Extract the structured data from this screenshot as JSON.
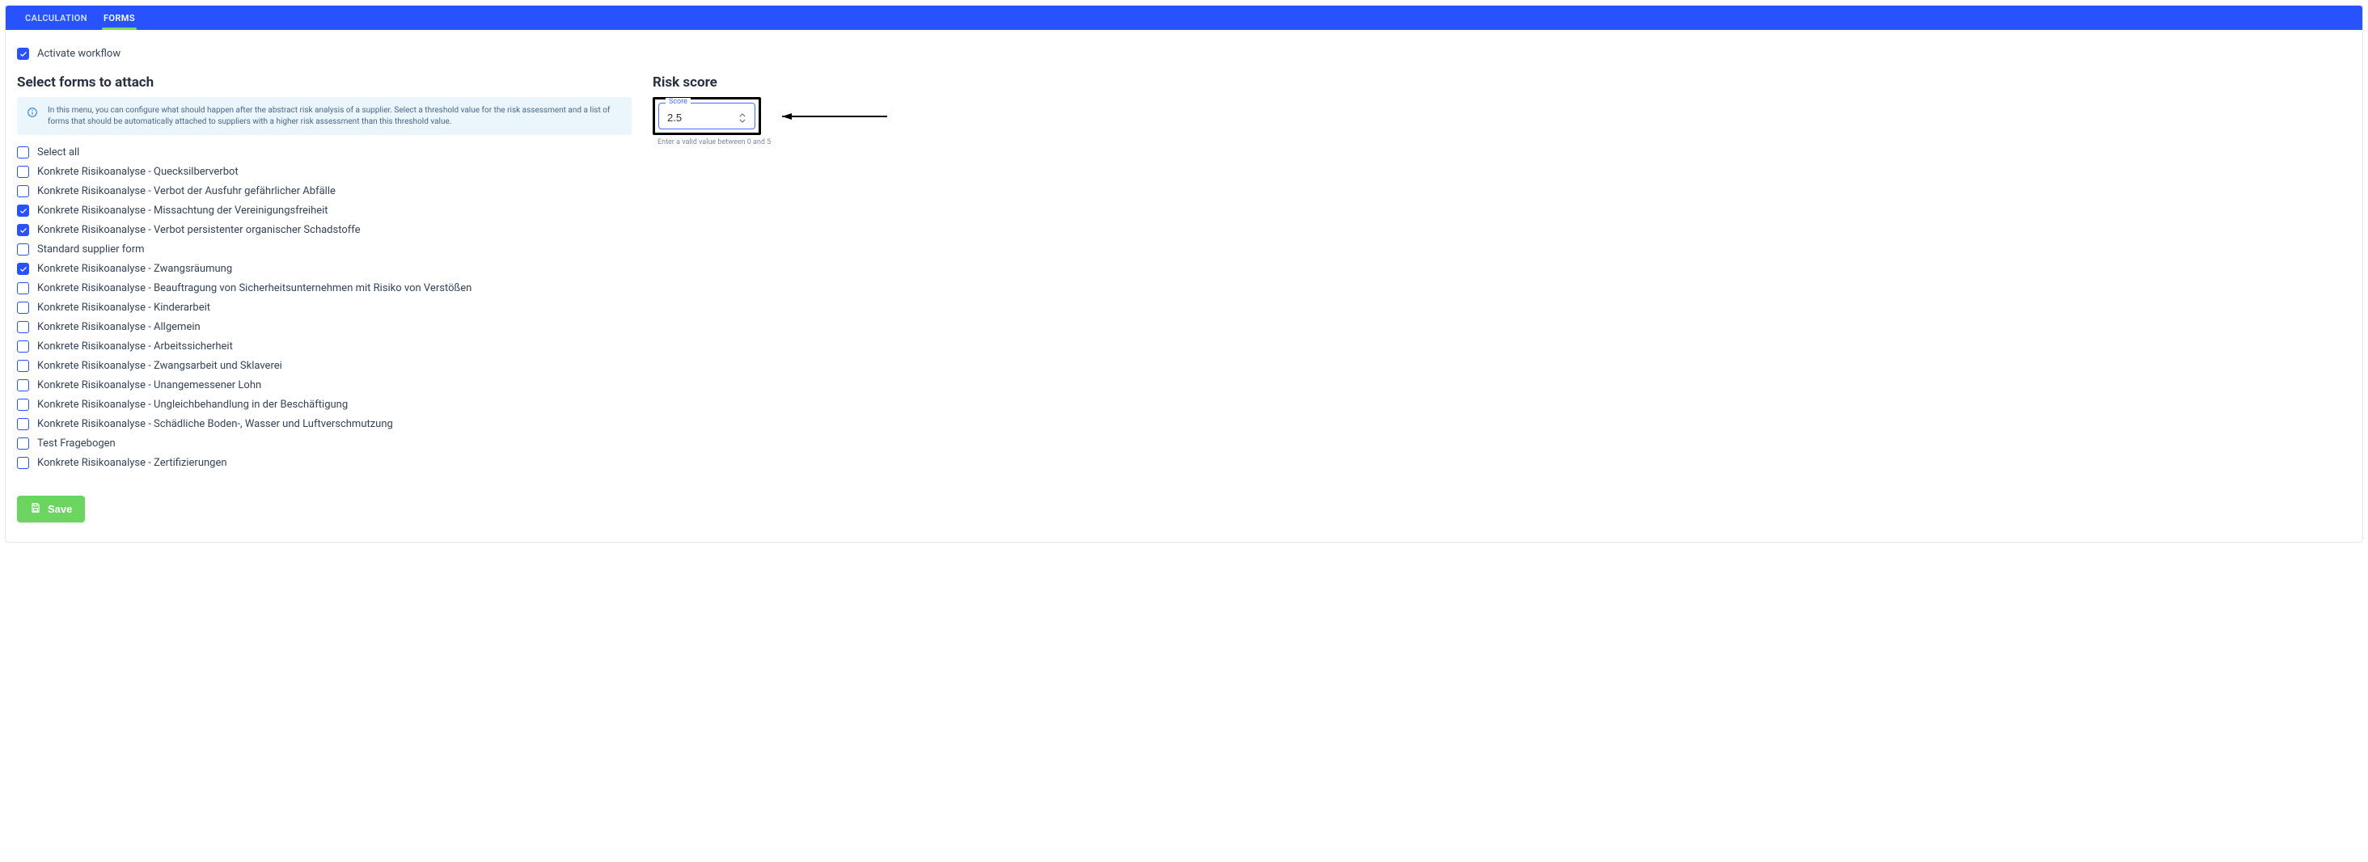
{
  "tabs": {
    "calculation": "CALCULATION",
    "forms": "FORMS"
  },
  "activate_label": "Activate workflow",
  "activate_checked": true,
  "section_title": "Select forms to attach",
  "info_text": "In this menu, you can configure what should happen after the abstract risk analysis of a supplier. Select a threshold value for the risk assessment and a list of forms that should be automatically attached to suppliers with a higher risk assessment than this threshold value.",
  "select_all_label": "Select all",
  "forms_list": [
    {
      "label": "Konkrete Risikoanalyse - Quecksilberverbot",
      "checked": false
    },
    {
      "label": "Konkrete Risikoanalyse - Verbot der Ausfuhr gefährlicher Abfälle",
      "checked": false
    },
    {
      "label": "Konkrete Risikoanalyse - Missachtung der Vereinigungsfreiheit",
      "checked": true
    },
    {
      "label": "Konkrete Risikoanalyse - Verbot persistenter organischer Schadstoffe",
      "checked": true
    },
    {
      "label": "Standard supplier form",
      "checked": false
    },
    {
      "label": "Konkrete Risikoanalyse - Zwangsräumung",
      "checked": true
    },
    {
      "label": "Konkrete Risikoanalyse - Beauftragung von Sicherheitsunternehmen mit Risiko von Verstößen",
      "checked": false
    },
    {
      "label": "Konkrete Risikoanalyse - Kinderarbeit",
      "checked": false
    },
    {
      "label": "Konkrete Risikoanalyse - Allgemein",
      "checked": false
    },
    {
      "label": "Konkrete Risikoanalyse - Arbeitssicherheit",
      "checked": false
    },
    {
      "label": "Konkrete Risikoanalyse - Zwangsarbeit und Sklaverei",
      "checked": false
    },
    {
      "label": "Konkrete Risikoanalyse - Unangemessener Lohn",
      "checked": false
    },
    {
      "label": "Konkrete Risikoanalyse - Ungleichbehandlung in der Beschäftigung",
      "checked": false
    },
    {
      "label": "Konkrete Risikoanalyse - Schädliche Boden-, Wasser und Luftverschmutzung",
      "checked": false
    },
    {
      "label": "Test Fragebogen",
      "checked": false
    },
    {
      "label": "Konkrete Risikoanalyse - Zertifizierungen",
      "checked": false
    }
  ],
  "risk": {
    "heading": "Risk score",
    "legend": "Score",
    "value": "2.5",
    "help": "Enter a valid value between 0 and 5"
  },
  "save_label": "Save"
}
